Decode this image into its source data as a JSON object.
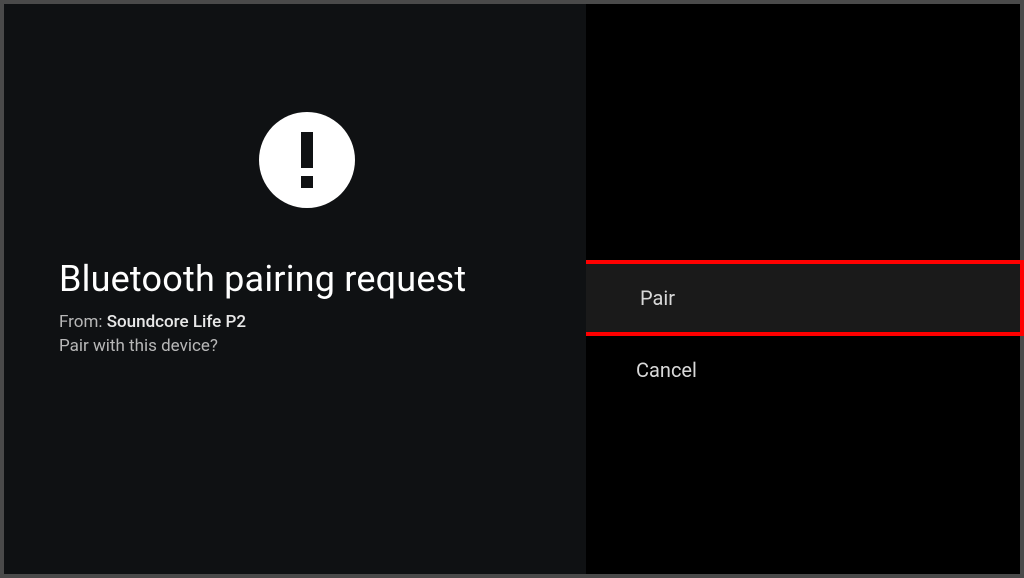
{
  "dialog": {
    "title": "Bluetooth pairing request",
    "from_label": "From: ",
    "device_name": "Soundcore Life P2",
    "prompt": "Pair with this device?"
  },
  "actions": {
    "pair_label": "Pair",
    "cancel_label": "Cancel"
  },
  "highlight": {
    "color": "#ff0000"
  }
}
